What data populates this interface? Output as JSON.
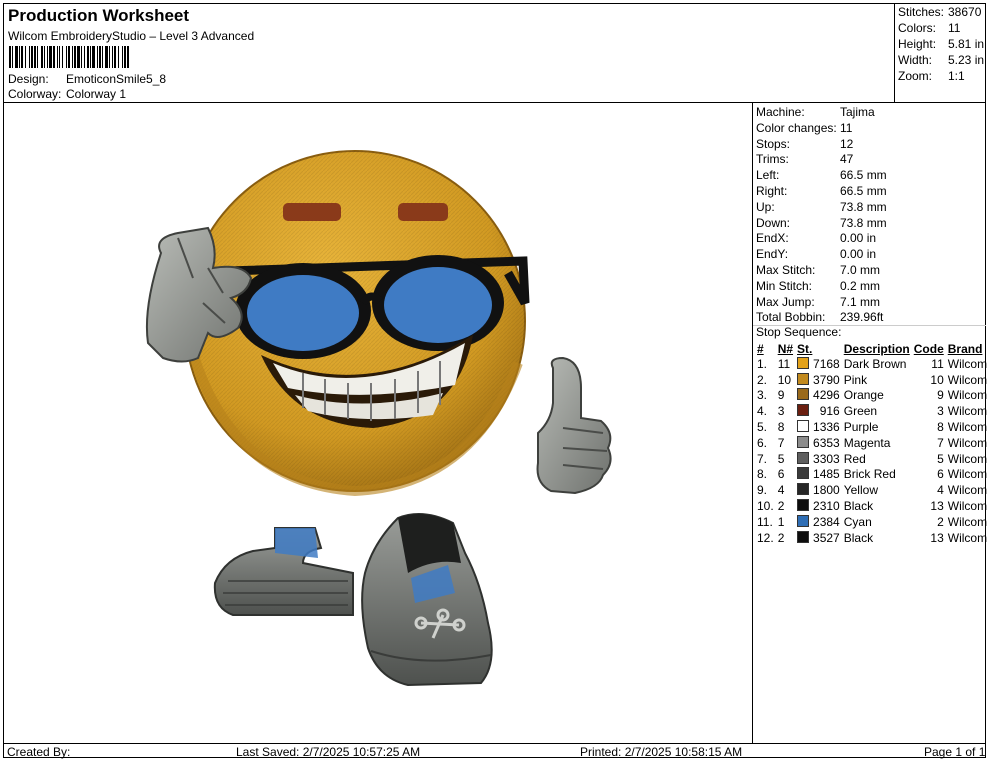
{
  "header": {
    "title": "Production Worksheet",
    "subtitle": "Wilcom EmbroideryStudio – Level 3 Advanced",
    "design_label": "Design:",
    "design_value": "EmoticonSmile5_8",
    "colorway_label": "Colorway:",
    "colorway_value": "Colorway 1"
  },
  "summary": [
    {
      "label": "Stitches:",
      "value": "38670"
    },
    {
      "label": "Colors:",
      "value": "11"
    },
    {
      "label": "Height:",
      "value": "5.81 in"
    },
    {
      "label": "Width:",
      "value": "5.23 in"
    },
    {
      "label": "Zoom:",
      "value": "1:1"
    }
  ],
  "machine_info": [
    {
      "label": "Machine:",
      "value": "Tajima"
    },
    {
      "label": "Color changes:",
      "value": "11"
    },
    {
      "label": "Stops:",
      "value": "12"
    },
    {
      "label": "Trims:",
      "value": "47"
    },
    {
      "label": "Left:",
      "value": "66.5 mm"
    },
    {
      "label": "Right:",
      "value": "66.5 mm"
    },
    {
      "label": "Up:",
      "value": "73.8 mm"
    },
    {
      "label": "Down:",
      "value": "73.8 mm"
    },
    {
      "label": "EndX:",
      "value": "0.00 in"
    },
    {
      "label": "EndY:",
      "value": "0.00 in"
    },
    {
      "label": "Max Stitch:",
      "value": "7.0 mm"
    },
    {
      "label": "Min Stitch:",
      "value": "0.2 mm"
    },
    {
      "label": "Max Jump:",
      "value": "7.1 mm"
    },
    {
      "label": "Total Bobbin:",
      "value": "239.96ft"
    }
  ],
  "stop_sequence": {
    "title": "Stop Sequence:",
    "columns": [
      "#",
      "N#",
      "St.",
      "Description",
      "Code",
      "Brand"
    ],
    "rows": [
      {
        "n": "1.",
        "needle": "11",
        "color": "#e3a21a",
        "stitches": "7168",
        "desc": "Dark Brown",
        "code": "11",
        "brand": "Wilcom"
      },
      {
        "n": "2.",
        "needle": "10",
        "color": "#c28a1e",
        "stitches": "3790",
        "desc": "Pink",
        "code": "10",
        "brand": "Wilcom"
      },
      {
        "n": "3.",
        "needle": "9",
        "color": "#9a6a1c",
        "stitches": "4296",
        "desc": "Orange",
        "code": "9",
        "brand": "Wilcom"
      },
      {
        "n": "4.",
        "needle": "3",
        "color": "#6b1f10",
        "stitches": "916",
        "desc": "Green",
        "code": "3",
        "brand": "Wilcom"
      },
      {
        "n": "5.",
        "needle": "8",
        "color": "#ffffff",
        "stitches": "1336",
        "desc": "Purple",
        "code": "8",
        "brand": "Wilcom"
      },
      {
        "n": "6.",
        "needle": "7",
        "color": "#8c8c8c",
        "stitches": "6353",
        "desc": "Magenta",
        "code": "7",
        "brand": "Wilcom"
      },
      {
        "n": "7.",
        "needle": "5",
        "color": "#5e5e5e",
        "stitches": "3303",
        "desc": "Red",
        "code": "5",
        "brand": "Wilcom"
      },
      {
        "n": "8.",
        "needle": "6",
        "color": "#3a3a3a",
        "stitches": "1485",
        "desc": "Brick Red",
        "code": "6",
        "brand": "Wilcom"
      },
      {
        "n": "9.",
        "needle": "4",
        "color": "#262626",
        "stitches": "1800",
        "desc": "Yellow",
        "code": "4",
        "brand": "Wilcom"
      },
      {
        "n": "10.",
        "needle": "2",
        "color": "#0d0d0d",
        "stitches": "2310",
        "desc": "Black",
        "code": "13",
        "brand": "Wilcom"
      },
      {
        "n": "11.",
        "needle": "1",
        "color": "#2f6eb5",
        "stitches": "2384",
        "desc": "Cyan",
        "code": "2",
        "brand": "Wilcom"
      },
      {
        "n": "12.",
        "needle": "2",
        "color": "#0d0d0d",
        "stitches": "3527",
        "desc": "Black",
        "code": "13",
        "brand": "Wilcom"
      }
    ]
  },
  "footer": {
    "created_by": "Created By:",
    "last_saved": "Last Saved: 2/7/2025 10:57:25 AM",
    "printed": "Printed: 2/7/2025 10:58:15 AM",
    "page": "Page 1 of 1"
  },
  "colors": {
    "face": "#d9a026",
    "face_shadow": "#b07c18",
    "eyebrow": "#8a3a1a",
    "lens": "#3f7bc4",
    "frame": "#111111",
    "glove": "#8e918c",
    "shoe": "#6b6e6a"
  }
}
